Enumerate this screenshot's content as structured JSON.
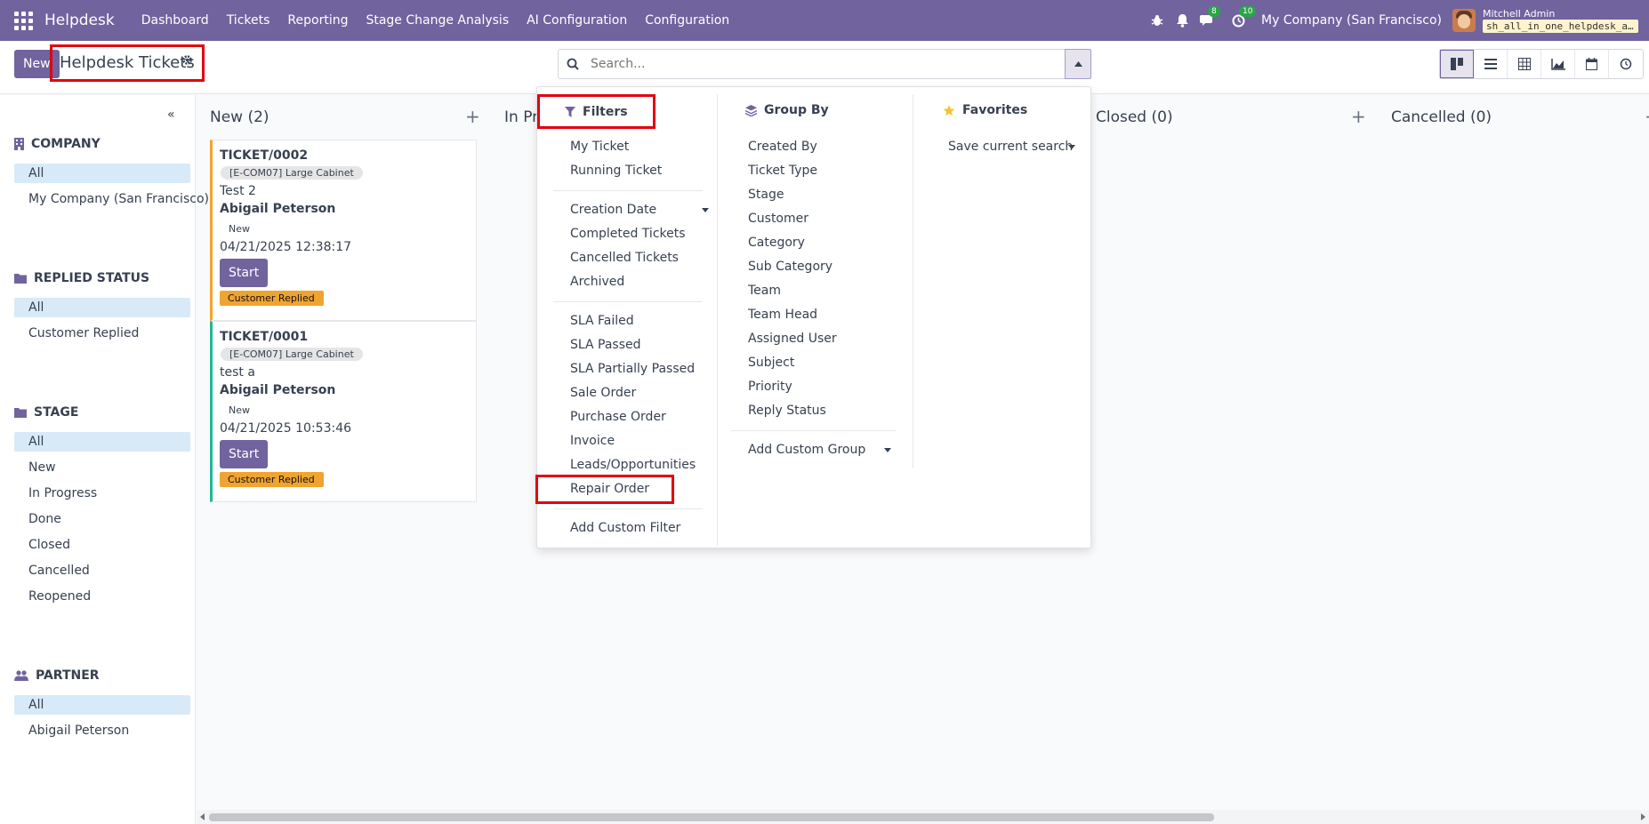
{
  "navbar": {
    "brand": "Helpdesk",
    "menu": [
      "Dashboard",
      "Tickets",
      "Reporting",
      "Stage Change Analysis",
      "AI Configuration",
      "Configuration"
    ],
    "chat_count": "8",
    "activity_count": "10",
    "company": "My Company (San Francisco)",
    "user": "Mitchell Admin",
    "database": "sh_all_in_one_helpdesk_a…"
  },
  "control_panel": {
    "new_label": "New",
    "title": "Helpdesk Tickets",
    "search_placeholder": "Search..."
  },
  "side_panel": {
    "sections": [
      {
        "title": "COMPANY",
        "items": [
          "All",
          "My Company (San Francisco)"
        ]
      },
      {
        "title": "REPLIED STATUS",
        "items": [
          "All",
          "Customer Replied"
        ]
      },
      {
        "title": "STAGE",
        "items": [
          "All",
          "New",
          "In Progress",
          "Done",
          "Closed",
          "Cancelled",
          "Reopened"
        ]
      },
      {
        "title": "PARTNER",
        "items": [
          "All",
          "Abigail Peterson"
        ]
      }
    ]
  },
  "kanban": {
    "columns": [
      {
        "title": "New (2)"
      },
      {
        "title": "In Pr"
      },
      {
        "title": "Closed (0)"
      },
      {
        "title": "Cancelled (0)"
      }
    ],
    "cards": [
      {
        "ref": "TICKET/0002",
        "tag": "[E-COM07] Large Cabinet",
        "desc": "Test 2",
        "partner": "Abigail Peterson",
        "stage": "New",
        "date": "04/21/2025 12:38:17",
        "button": "Start",
        "status": "Customer Replied"
      },
      {
        "ref": "TICKET/0001",
        "tag": "[E-COM07] Large Cabinet",
        "desc": "test a",
        "partner": "Abigail Peterson",
        "stage": "New",
        "date": "04/21/2025 10:53:46",
        "button": "Start",
        "status": "Customer Replied"
      }
    ]
  },
  "dropdown": {
    "filters_title": "Filters",
    "filters": {
      "group1": [
        "My Ticket",
        "Running Ticket"
      ],
      "group2": [
        "Creation Date",
        "Completed Tickets",
        "Cancelled Tickets",
        "Archived"
      ],
      "group3": [
        "SLA Failed",
        "SLA Passed",
        "SLA Partially Passed",
        "Sale Order",
        "Purchase Order",
        "Invoice",
        "Leads/Opportunities",
        "Repair Order"
      ],
      "custom": "Add Custom Filter"
    },
    "groupby_title": "Group By",
    "groupby": [
      "Created By",
      "Ticket Type",
      "Stage",
      "Customer",
      "Category",
      "Sub Category",
      "Team",
      "Team Head",
      "Assigned User",
      "Subject",
      "Priority",
      "Reply Status"
    ],
    "groupby_custom": "Add Custom Group",
    "favorites_title": "Favorites",
    "favorites_save": "Save current search"
  },
  "colors": {
    "brand": "#71639e",
    "highlight": "#e3000f",
    "status_orange": "#f0a430",
    "active_filter": "#d8eaf7"
  }
}
